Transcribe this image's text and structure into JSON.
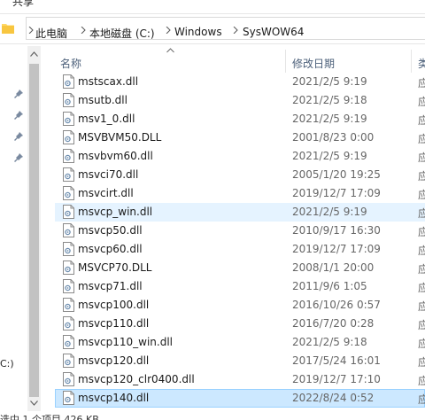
{
  "ribbon": {
    "partial_label": "共享"
  },
  "address": {
    "crumbs": [
      "此电脑",
      "本地磁盘 (C:)",
      "Windows",
      "SysWOW64"
    ]
  },
  "nav": {
    "drive_label_partial": "C:)"
  },
  "columns": {
    "name": "名称",
    "date": "修改日期",
    "type_partial": "类"
  },
  "files": [
    {
      "name": "mstscax.dll",
      "date": "2021/2/5 9:19",
      "type_cut": "应"
    },
    {
      "name": "msutb.dll",
      "date": "2021/2/5 9:18",
      "type_cut": "应"
    },
    {
      "name": "msv1_0.dll",
      "date": "2021/2/5 9:19",
      "type_cut": "应"
    },
    {
      "name": "MSVBVM50.DLL",
      "date": "2001/8/23 0:00",
      "type_cut": "应"
    },
    {
      "name": "msvbvm60.dll",
      "date": "2021/2/5 9:19",
      "type_cut": "应"
    },
    {
      "name": "msvci70.dll",
      "date": "2005/1/20 19:25",
      "type_cut": "应"
    },
    {
      "name": "msvcirt.dll",
      "date": "2019/12/7 17:09",
      "type_cut": "应"
    },
    {
      "name": "msvcp_win.dll",
      "date": "2021/2/5 9:19",
      "type_cut": "应"
    },
    {
      "name": "msvcp50.dll",
      "date": "2010/9/17 16:30",
      "type_cut": "应"
    },
    {
      "name": "msvcp60.dll",
      "date": "2019/12/7 17:09",
      "type_cut": "应"
    },
    {
      "name": "MSVCP70.DLL",
      "date": "2008/1/1 20:00",
      "type_cut": "应"
    },
    {
      "name": "msvcp71.dll",
      "date": "2011/9/6 1:05",
      "type_cut": "应"
    },
    {
      "name": "msvcp100.dll",
      "date": "2016/10/26 0:57",
      "type_cut": "应"
    },
    {
      "name": "msvcp110.dll",
      "date": "2016/7/20 0:28",
      "type_cut": "应"
    },
    {
      "name": "msvcp110_win.dll",
      "date": "2021/2/5 9:18",
      "type_cut": "应"
    },
    {
      "name": "msvcp120.dll",
      "date": "2017/5/24 16:01",
      "type_cut": "应"
    },
    {
      "name": "msvcp120_clr0400.dll",
      "date": "2019/12/7 17:10",
      "type_cut": "应"
    },
    {
      "name": "msvcp140.dll",
      "date": "2022/8/24 0:52",
      "type_cut": "应"
    }
  ],
  "status": {
    "text": "选中 1 个项目  426 KB"
  }
}
